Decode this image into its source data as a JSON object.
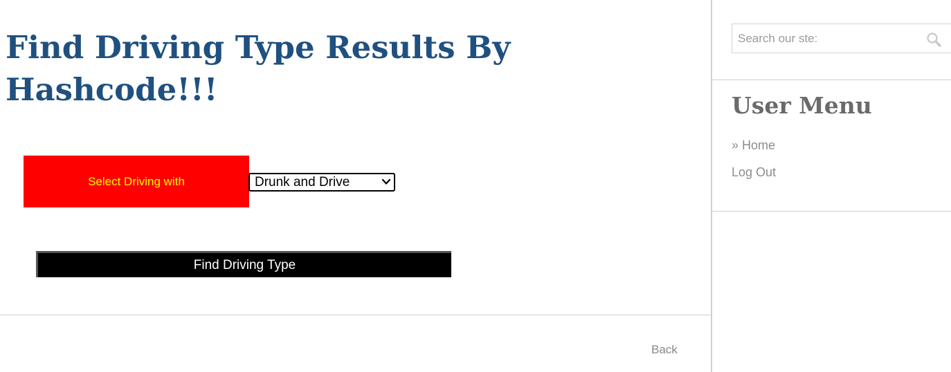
{
  "main": {
    "title": "Find Driving Type Results By Hashcode!!!",
    "select_label": "Select Driving with",
    "select": {
      "selected_value": "Drunk and Drive"
    },
    "find_button_label": "Find Driving Type",
    "back_link": "Back"
  },
  "sidebar": {
    "search": {
      "placeholder": "Search our ste:"
    },
    "menu_title": "User Menu",
    "menu_items": [
      {
        "label": "» Home"
      },
      {
        "label": "Log Out"
      }
    ]
  },
  "colors": {
    "title": "#1f5080",
    "label_background": "#ff0000",
    "label_text": "#ffff00",
    "button_background": "#000000",
    "menu_title": "#6a6a6a",
    "link_gray": "#8c8c8c"
  },
  "icons": {
    "search": "search-icon",
    "dropdown": "chevron-down-icon"
  }
}
